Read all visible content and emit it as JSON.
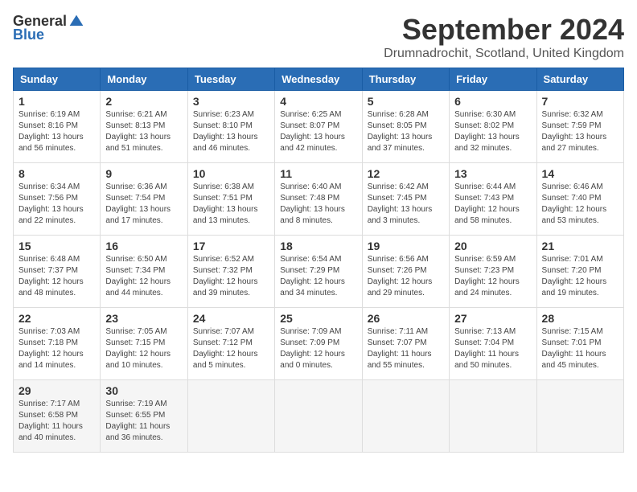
{
  "logo": {
    "general": "General",
    "blue": "Blue"
  },
  "title": "September 2024",
  "location": "Drumnadrochit, Scotland, United Kingdom",
  "headers": [
    "Sunday",
    "Monday",
    "Tuesday",
    "Wednesday",
    "Thursday",
    "Friday",
    "Saturday"
  ],
  "weeks": [
    [
      {
        "day": "1",
        "sunrise": "6:19 AM",
        "sunset": "8:16 PM",
        "daylight": "13 hours and 56 minutes."
      },
      {
        "day": "2",
        "sunrise": "6:21 AM",
        "sunset": "8:13 PM",
        "daylight": "13 hours and 51 minutes."
      },
      {
        "day": "3",
        "sunrise": "6:23 AM",
        "sunset": "8:10 PM",
        "daylight": "13 hours and 46 minutes."
      },
      {
        "day": "4",
        "sunrise": "6:25 AM",
        "sunset": "8:07 PM",
        "daylight": "13 hours and 42 minutes."
      },
      {
        "day": "5",
        "sunrise": "6:28 AM",
        "sunset": "8:05 PM",
        "daylight": "13 hours and 37 minutes."
      },
      {
        "day": "6",
        "sunrise": "6:30 AM",
        "sunset": "8:02 PM",
        "daylight": "13 hours and 32 minutes."
      },
      {
        "day": "7",
        "sunrise": "6:32 AM",
        "sunset": "7:59 PM",
        "daylight": "13 hours and 27 minutes."
      }
    ],
    [
      {
        "day": "8",
        "sunrise": "6:34 AM",
        "sunset": "7:56 PM",
        "daylight": "13 hours and 22 minutes."
      },
      {
        "day": "9",
        "sunrise": "6:36 AM",
        "sunset": "7:54 PM",
        "daylight": "13 hours and 17 minutes."
      },
      {
        "day": "10",
        "sunrise": "6:38 AM",
        "sunset": "7:51 PM",
        "daylight": "13 hours and 13 minutes."
      },
      {
        "day": "11",
        "sunrise": "6:40 AM",
        "sunset": "7:48 PM",
        "daylight": "13 hours and 8 minutes."
      },
      {
        "day": "12",
        "sunrise": "6:42 AM",
        "sunset": "7:45 PM",
        "daylight": "13 hours and 3 minutes."
      },
      {
        "day": "13",
        "sunrise": "6:44 AM",
        "sunset": "7:43 PM",
        "daylight": "12 hours and 58 minutes."
      },
      {
        "day": "14",
        "sunrise": "6:46 AM",
        "sunset": "7:40 PM",
        "daylight": "12 hours and 53 minutes."
      }
    ],
    [
      {
        "day": "15",
        "sunrise": "6:48 AM",
        "sunset": "7:37 PM",
        "daylight": "12 hours and 48 minutes."
      },
      {
        "day": "16",
        "sunrise": "6:50 AM",
        "sunset": "7:34 PM",
        "daylight": "12 hours and 44 minutes."
      },
      {
        "day": "17",
        "sunrise": "6:52 AM",
        "sunset": "7:32 PM",
        "daylight": "12 hours and 39 minutes."
      },
      {
        "day": "18",
        "sunrise": "6:54 AM",
        "sunset": "7:29 PM",
        "daylight": "12 hours and 34 minutes."
      },
      {
        "day": "19",
        "sunrise": "6:56 AM",
        "sunset": "7:26 PM",
        "daylight": "12 hours and 29 minutes."
      },
      {
        "day": "20",
        "sunrise": "6:59 AM",
        "sunset": "7:23 PM",
        "daylight": "12 hours and 24 minutes."
      },
      {
        "day": "21",
        "sunrise": "7:01 AM",
        "sunset": "7:20 PM",
        "daylight": "12 hours and 19 minutes."
      }
    ],
    [
      {
        "day": "22",
        "sunrise": "7:03 AM",
        "sunset": "7:18 PM",
        "daylight": "12 hours and 14 minutes."
      },
      {
        "day": "23",
        "sunrise": "7:05 AM",
        "sunset": "7:15 PM",
        "daylight": "12 hours and 10 minutes."
      },
      {
        "day": "24",
        "sunrise": "7:07 AM",
        "sunset": "7:12 PM",
        "daylight": "12 hours and 5 minutes."
      },
      {
        "day": "25",
        "sunrise": "7:09 AM",
        "sunset": "7:09 PM",
        "daylight": "12 hours and 0 minutes."
      },
      {
        "day": "26",
        "sunrise": "7:11 AM",
        "sunset": "7:07 PM",
        "daylight": "11 hours and 55 minutes."
      },
      {
        "day": "27",
        "sunrise": "7:13 AM",
        "sunset": "7:04 PM",
        "daylight": "11 hours and 50 minutes."
      },
      {
        "day": "28",
        "sunrise": "7:15 AM",
        "sunset": "7:01 PM",
        "daylight": "11 hours and 45 minutes."
      }
    ],
    [
      {
        "day": "29",
        "sunrise": "7:17 AM",
        "sunset": "6:58 PM",
        "daylight": "11 hours and 40 minutes."
      },
      {
        "day": "30",
        "sunrise": "7:19 AM",
        "sunset": "6:55 PM",
        "daylight": "11 hours and 36 minutes."
      },
      null,
      null,
      null,
      null,
      null
    ]
  ]
}
